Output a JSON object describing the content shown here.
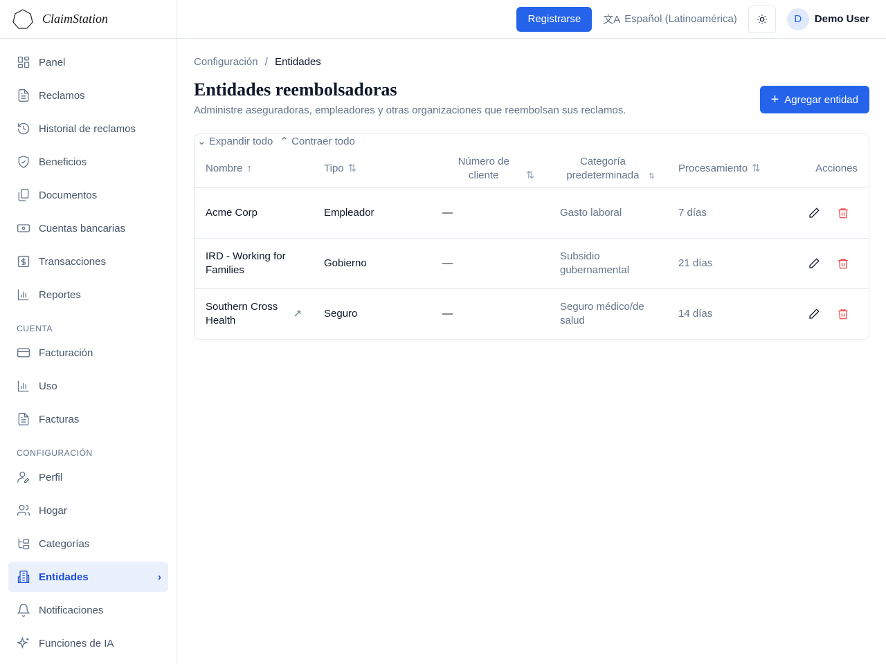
{
  "app": {
    "name": "ClaimStation"
  },
  "sidebar": {
    "items": [
      {
        "label": "Panel",
        "icon": "dashboard-icon"
      },
      {
        "label": "Reclamos",
        "icon": "file-icon"
      },
      {
        "label": "Historial de reclamos",
        "icon": "history-icon"
      },
      {
        "label": "Beneficios",
        "icon": "shield-icon"
      },
      {
        "label": "Documentos",
        "icon": "documents-icon"
      },
      {
        "label": "Cuentas bancarias",
        "icon": "banknote-icon"
      },
      {
        "label": "Transacciones",
        "icon": "dollar-icon"
      },
      {
        "label": "Reportes",
        "icon": "chart-icon"
      }
    ],
    "section_account": "CUENTA",
    "account_items": [
      {
        "label": "Facturación",
        "icon": "credit-card-icon"
      },
      {
        "label": "Uso",
        "icon": "chart-icon"
      },
      {
        "label": "Facturas",
        "icon": "file-icon"
      }
    ],
    "section_settings": "CONFIGURACIÓN",
    "settings_items": [
      {
        "label": "Perfil",
        "icon": "user-pen-icon"
      },
      {
        "label": "Hogar",
        "icon": "users-icon"
      },
      {
        "label": "Categorías",
        "icon": "tree-icon"
      },
      {
        "label": "Entidades",
        "icon": "building-icon",
        "active": true
      },
      {
        "label": "Notificaciones",
        "icon": "bell-icon"
      },
      {
        "label": "Funciones de IA",
        "icon": "sparkles-icon"
      }
    ]
  },
  "topbar": {
    "register": "Registrarse",
    "language": "Español (Latinoamérica)",
    "avatar_initial": "D",
    "user": "Demo User"
  },
  "breadcrumb": {
    "parent": "Configuración",
    "sep": "/",
    "current": "Entidades"
  },
  "page": {
    "title": "Entidades reembolsadoras",
    "subtitle": "Administre aseguradoras, empleadores y otras organizaciones que reembolsan sus reclamos.",
    "add_button": "Agregar entidad",
    "expand_all": "Expandir todo",
    "collapse_all": "Contraer todo"
  },
  "table": {
    "headers": [
      "Nombre",
      "Tipo",
      "Número de cliente",
      "Categoría predeterminada",
      "Procesamiento",
      "Acciones"
    ],
    "rows": [
      {
        "name": "Acme Corp",
        "type": "Empleador",
        "client": "—",
        "category": "Gasto laboral",
        "processing": "7 días"
      },
      {
        "name": "IRD - Working for Families",
        "type": "Gobierno",
        "client": "—",
        "category": "Subsidio gubernamental",
        "processing": "21 días"
      },
      {
        "name": "Southern Cross Health",
        "type": "Seguro",
        "client": "—",
        "category": "Seguro médico/de salud",
        "processing": "14 días",
        "link": true
      }
    ]
  },
  "colors": {
    "primary": "#2563eb",
    "danger": "#ef4444"
  }
}
